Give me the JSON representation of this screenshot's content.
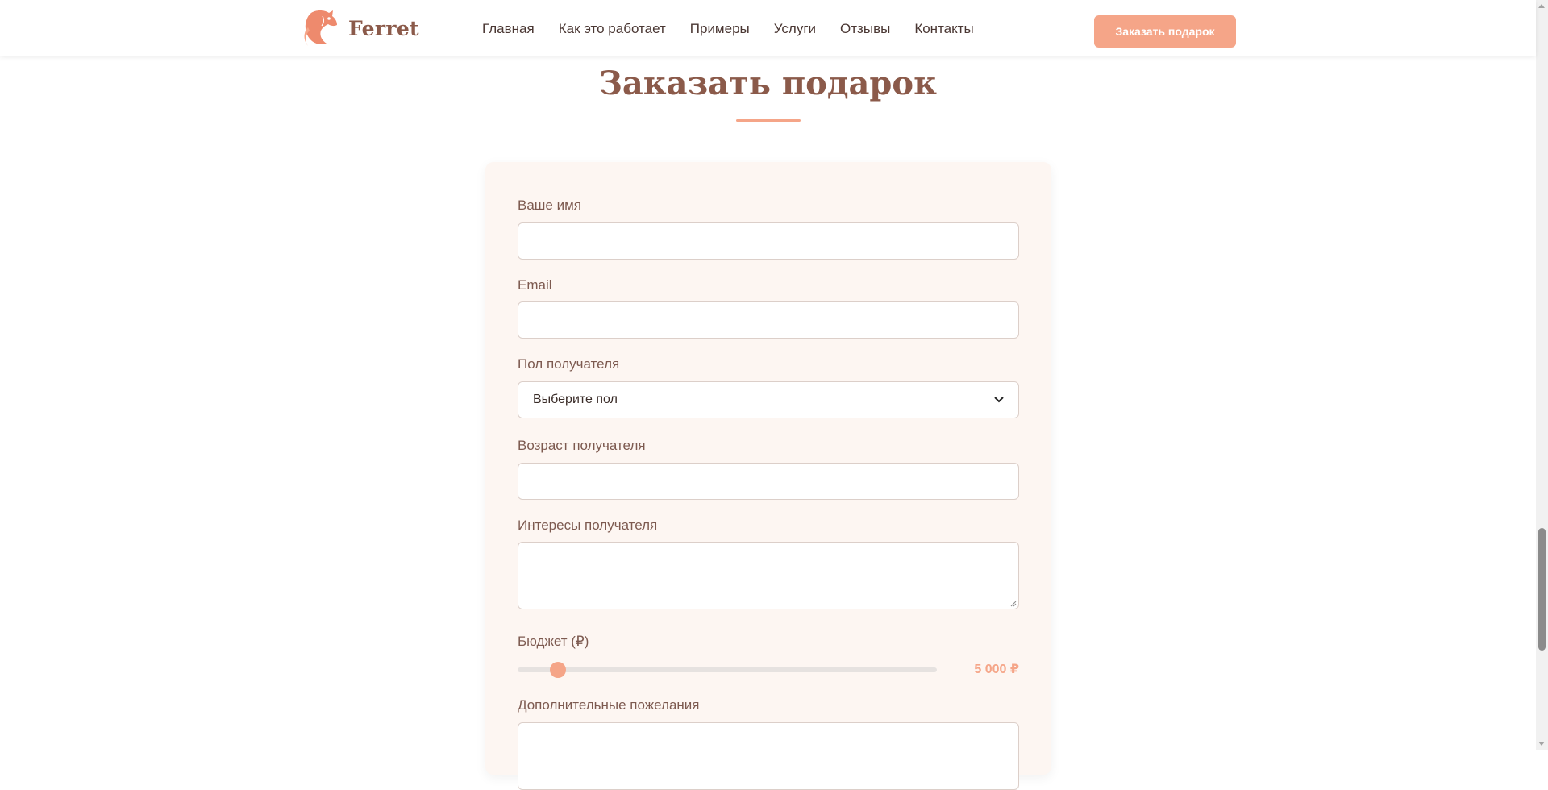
{
  "brand": {
    "name": "Ferret"
  },
  "nav": {
    "items": [
      {
        "label": "Главная"
      },
      {
        "label": "Как это работает"
      },
      {
        "label": "Примеры"
      },
      {
        "label": "Услуги"
      },
      {
        "label": "Отзывы"
      },
      {
        "label": "Контакты"
      }
    ],
    "cta_label": "Заказать подарок"
  },
  "section": {
    "title": "Заказать подарок"
  },
  "form": {
    "name": {
      "label": "Ваше имя",
      "value": ""
    },
    "email": {
      "label": "Email",
      "value": ""
    },
    "gender": {
      "label": "Пол получателя",
      "selected": "Выберите пол"
    },
    "age": {
      "label": "Возраст получателя",
      "value": ""
    },
    "interests": {
      "label": "Интересы получателя",
      "value": ""
    },
    "budget": {
      "label": "Бюджет (₽)",
      "value_text": "5 000 ₽",
      "value": 5000,
      "fraction": 0.097
    },
    "extra": {
      "label": "Дополнительные пожелания",
      "value": ""
    }
  },
  "colors": {
    "accent": "#f5a588",
    "brand_text": "#8b5a4a",
    "card_bg": "#fdf6f2"
  }
}
